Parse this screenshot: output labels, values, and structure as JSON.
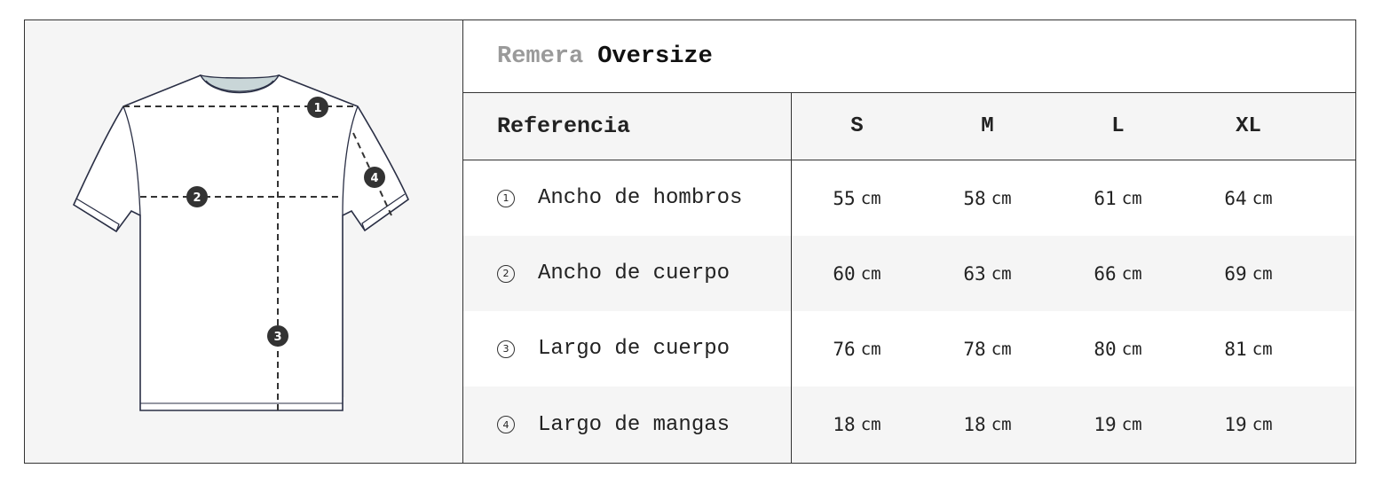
{
  "product": {
    "title_light": "Remera",
    "title_bold": "Oversize"
  },
  "table": {
    "header": {
      "reference": "Referencia",
      "sizes": [
        "S",
        "M",
        "L",
        "XL"
      ]
    },
    "unit": "cm",
    "rows": [
      {
        "num": "1",
        "label": "Ancho de hombros",
        "values": [
          "55",
          "58",
          "61",
          "64"
        ]
      },
      {
        "num": "2",
        "label": "Ancho de cuerpo",
        "values": [
          "60",
          "63",
          "66",
          "69"
        ]
      },
      {
        "num": "3",
        "label": "Largo de cuerpo",
        "values": [
          "76",
          "78",
          "80",
          "81"
        ]
      },
      {
        "num": "4",
        "label": "Largo de mangas",
        "values": [
          "18",
          "18",
          "19",
          "19"
        ]
      }
    ]
  },
  "illustration": {
    "icon": "tshirt-measurement-diagram",
    "markers": [
      "1",
      "2",
      "3",
      "4"
    ],
    "colors": {
      "collar": "#c9d6d8",
      "outline": "#2a2f45",
      "fill": "#ffffff",
      "shade": "#e9e9e9"
    }
  }
}
